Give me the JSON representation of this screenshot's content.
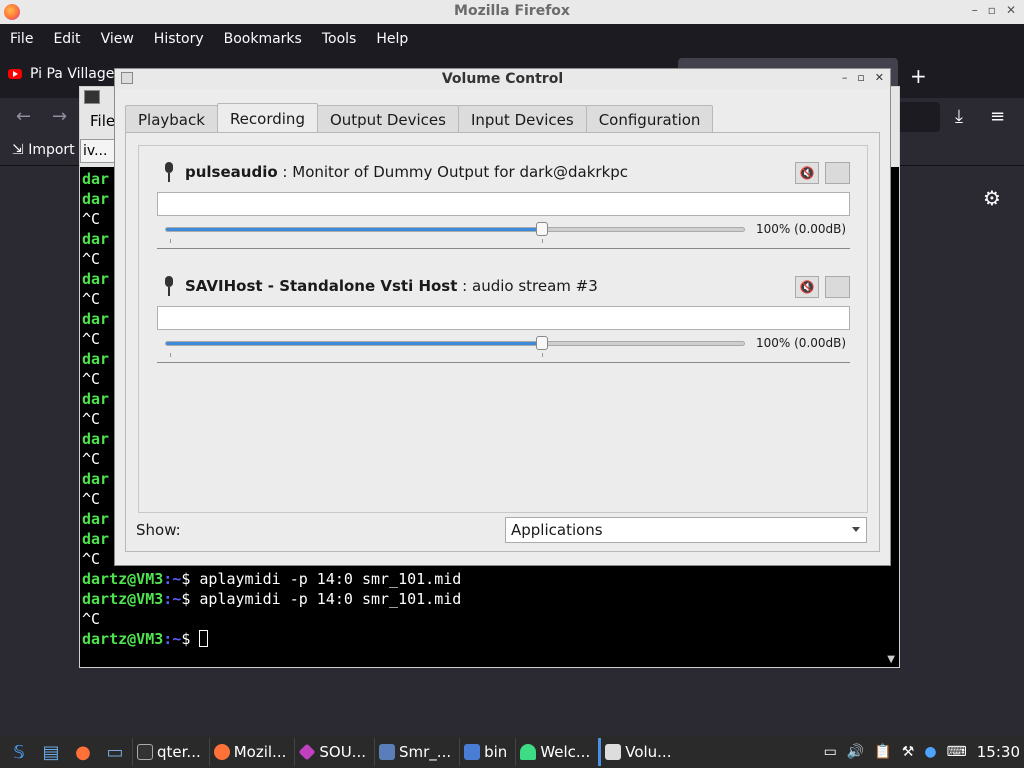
{
  "firefox": {
    "title": "Mozilla Firefox",
    "menu": [
      "File",
      "Edit",
      "View",
      "History",
      "Bookmarks",
      "Tools",
      "Help"
    ],
    "tab_label": "Pi Pa Village",
    "new_tab": "+",
    "import_label": "Import"
  },
  "terminal": {
    "file_menu": "File",
    "tab_label": "iv...",
    "lines": [
      {
        "prefix": "dar",
        "rest": ""
      },
      {
        "prefix": "dar",
        "rest": ""
      },
      {
        "prefix": "",
        "rest": "^C"
      },
      {
        "prefix": "dar",
        "rest": ""
      },
      {
        "prefix": "",
        "rest": "^C"
      },
      {
        "prefix": "dar",
        "rest": ""
      },
      {
        "prefix": "",
        "rest": "^C"
      },
      {
        "prefix": "dar",
        "rest": ""
      },
      {
        "prefix": "",
        "rest": "^C"
      },
      {
        "prefix": "dar",
        "rest": ""
      },
      {
        "prefix": "",
        "rest": "^C"
      },
      {
        "prefix": "dar",
        "rest": ""
      },
      {
        "prefix": "",
        "rest": "^C"
      },
      {
        "prefix": "dar",
        "rest": ""
      },
      {
        "prefix": "",
        "rest": "^C"
      },
      {
        "prefix": "dar",
        "rest": ""
      },
      {
        "prefix": "",
        "rest": "^C"
      },
      {
        "prefix": "dar",
        "rest": ""
      },
      {
        "prefix": "dar",
        "rest": ""
      },
      {
        "prefix": "",
        "rest": "^C"
      }
    ],
    "prompt_user": "dartz@VM3",
    "prompt_path": ":~",
    "prompt_sign": "$ ",
    "command1": "aplaymidi -p 14:0 smr_101.mid",
    "command2": "aplaymidi -p 14:0 smr_101.mid",
    "ctrl_c": "^C"
  },
  "volume_control": {
    "title": "Volume Control",
    "tabs": [
      "Playback",
      "Recording",
      "Output Devices",
      "Input Devices",
      "Configuration"
    ],
    "active_tab": "Recording",
    "streams": [
      {
        "app": "pulseaudio",
        "desc": " : Monitor of Dummy Output for dark@dakrkpc",
        "volume_text": "100% (0.00dB)",
        "volume_fraction": 0.65
      },
      {
        "app": "SAVIHost - Standalone Vsti Host",
        "desc": " : audio stream #3",
        "volume_text": "100% (0.00dB)",
        "volume_fraction": 0.65
      }
    ],
    "show_label": "Show:",
    "show_value": "Applications"
  },
  "taskbar": {
    "tasks": [
      "qter...",
      "Mozil...",
      "SOU...",
      "Smr_...",
      "bin",
      "Welc...",
      "Volu..."
    ],
    "clock": "15:30"
  }
}
